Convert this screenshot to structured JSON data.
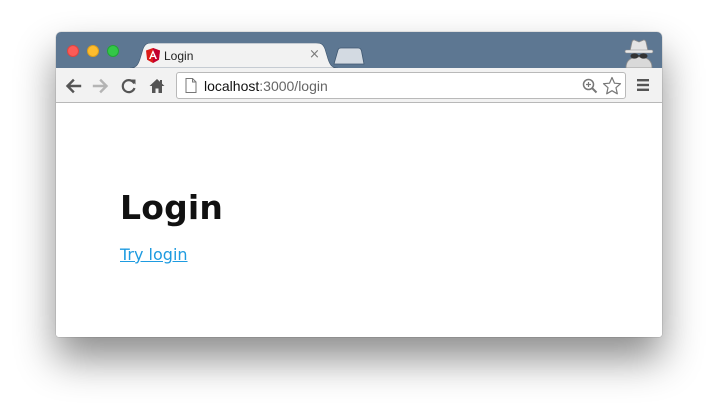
{
  "browser": {
    "tab": {
      "title": "Login",
      "favicon": "angular-logo-icon",
      "close_glyph": "×"
    },
    "address_bar": {
      "host": "localhost",
      "path": ":3000/login"
    },
    "colors": {
      "titlebar": "#5d7792",
      "toolbar": "#f2f2f2",
      "link": "#1e9be0",
      "close_red": "#fc5b57",
      "minimize_yellow": "#fdbc2e",
      "zoom_green": "#33c748"
    },
    "icons": [
      "back-arrow-icon",
      "forward-arrow-icon",
      "reload-icon",
      "home-icon",
      "page-icon",
      "zoom-icon",
      "star-icon",
      "menu-icon",
      "incognito-icon"
    ]
  },
  "page": {
    "heading": "Login",
    "link_label": "Try login"
  }
}
